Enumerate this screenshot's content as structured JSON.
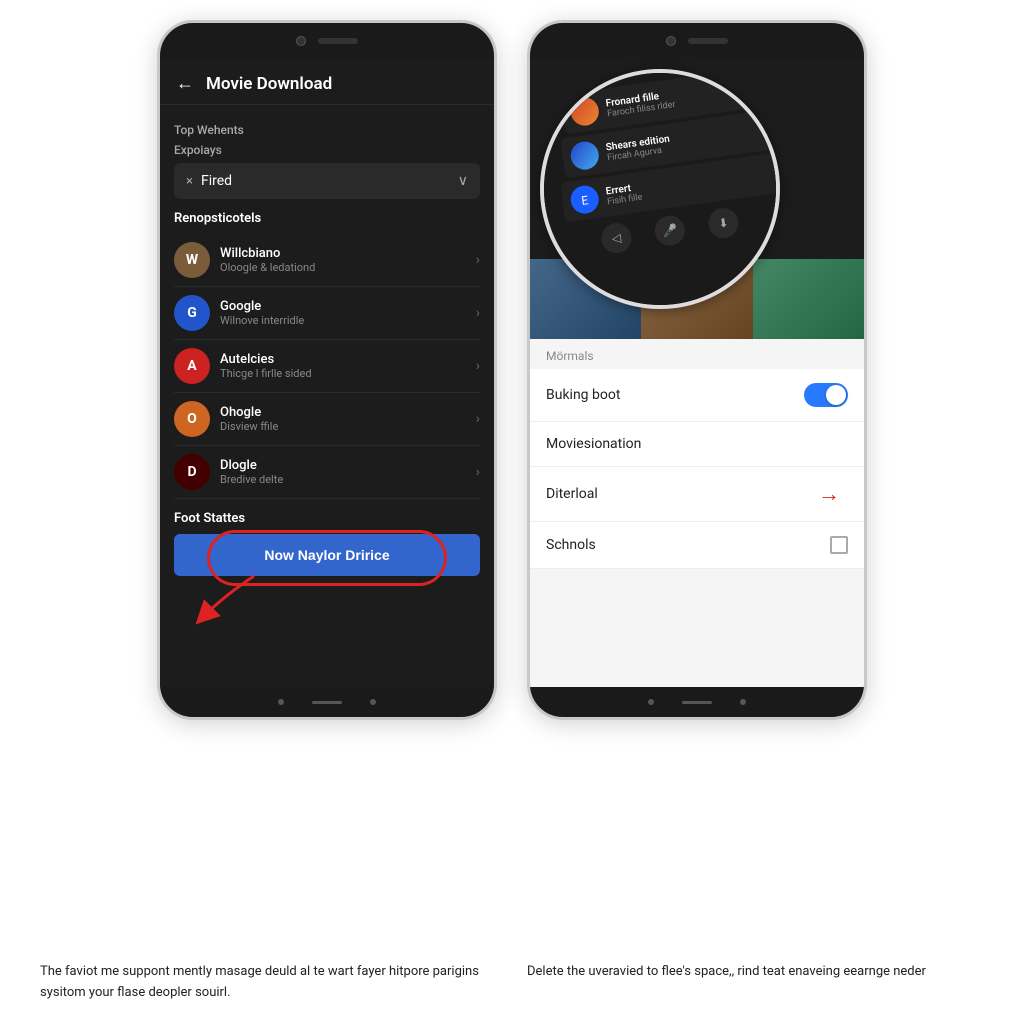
{
  "leftPhone": {
    "header": {
      "back": "←",
      "title": "Movie Download"
    },
    "topSection": "Top Wehents",
    "expiryLabel": "Expoiays",
    "dropdown": {
      "x": "×",
      "value": "Fired",
      "chevron": "∨"
    },
    "listSectionLabel": "Renopsticotels",
    "listItems": [
      {
        "name": "Willcbiano",
        "sub": "Oloogle & ledationd",
        "avatarColor": "avatar-brown",
        "letter": "W"
      },
      {
        "name": "Google",
        "sub": "Wilnove interridle",
        "avatarColor": "avatar-blue",
        "letter": "G"
      },
      {
        "name": "Autelcies",
        "sub": "Thicge l firlle sided",
        "avatarColor": "avatar-red",
        "letter": "A"
      },
      {
        "name": "Ohogle",
        "sub": "Disview ffile",
        "avatarColor": "avatar-orange",
        "letter": "O"
      },
      {
        "name": "Dlogle",
        "sub": "Bredive delte",
        "avatarColor": "avatar-dark",
        "letter": "D"
      }
    ],
    "footLabel": "Foot Stattes",
    "ctaButton": "Now Naylor Dririce"
  },
  "rightPhone": {
    "zoomItems": [
      {
        "title": "Fronard fille",
        "sub": "Faroch filiss rlder",
        "avatarClass": "za1"
      },
      {
        "title": "Shears edition",
        "sub": "Fircah Agurva",
        "avatarClass": "za2"
      },
      {
        "title": "Errert",
        "sub": "Fisih fille",
        "avatarClass": "za3"
      }
    ],
    "settingsSectionLabel": "Mörmals",
    "settingsRows": [
      {
        "label": "Buking boot",
        "type": "toggle"
      },
      {
        "label": "Moviesionation",
        "type": "text"
      },
      {
        "label": "Diterloal",
        "type": "arrow"
      },
      {
        "label": "Schnols",
        "type": "checkbox"
      }
    ]
  },
  "captions": {
    "left": "The faviot me suppont mently masage deuld al te wart fayer hitpore parigins sysitom your flase deopler souirl.",
    "right": "Delete the uveravied to flee's space,, rind teat enaveing eearnge neder"
  }
}
